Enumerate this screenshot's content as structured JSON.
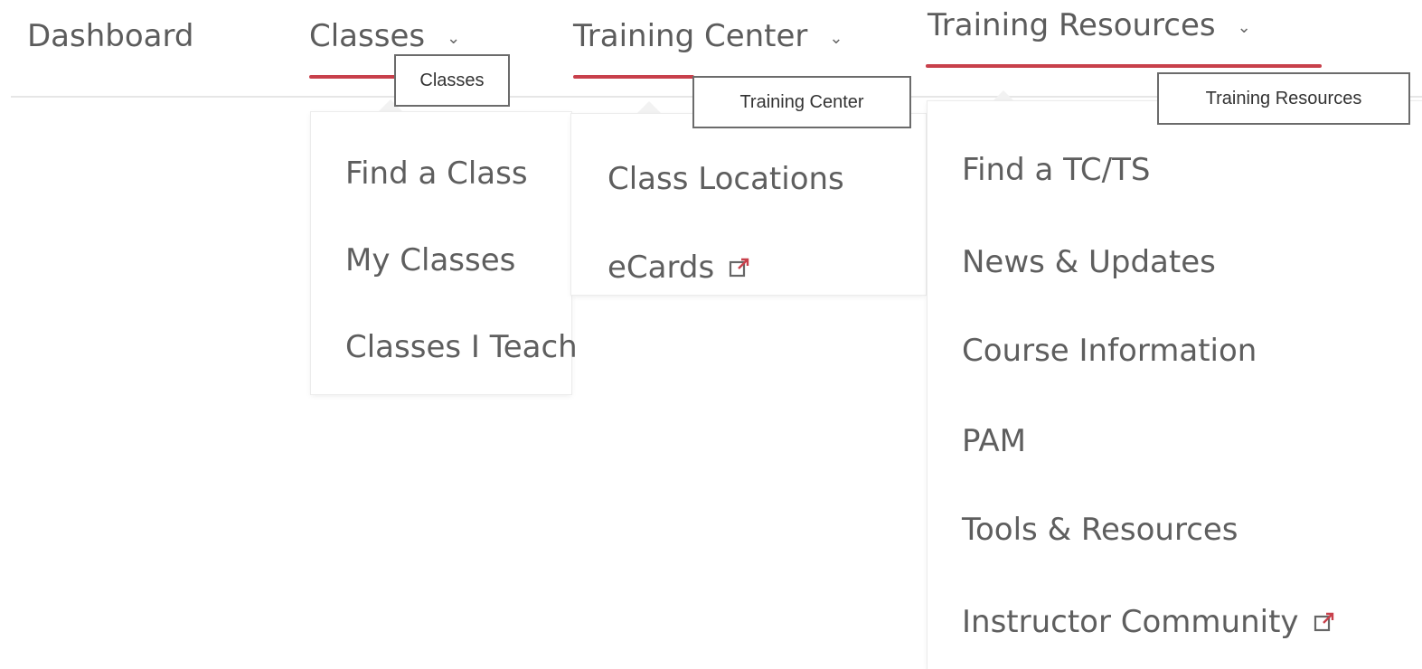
{
  "nav": {
    "items": [
      {
        "label": "Dashboard"
      },
      {
        "label": "Classes"
      },
      {
        "label": "Training Center"
      },
      {
        "label": "Training Resources"
      }
    ]
  },
  "tooltips": {
    "classes": "Classes",
    "training_center": "Training Center",
    "training_resources": "Training Resources"
  },
  "menus": {
    "classes": [
      "Find a Class",
      "My Classes",
      "Classes I Teach"
    ],
    "training_center": [
      "Class Locations",
      "eCards"
    ],
    "training_resources": [
      "Find a TC/TS",
      "News & Updates",
      "Course Information",
      "PAM",
      "Tools & Resources",
      "Instructor Community"
    ]
  },
  "icons": {
    "chevron": "chevron-down-icon",
    "external": "external-link-icon"
  },
  "colors": {
    "accent": "#c8404b",
    "text": "#5c5c5c"
  }
}
